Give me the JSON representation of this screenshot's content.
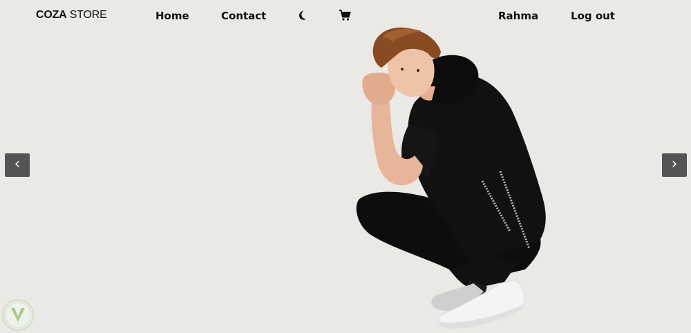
{
  "brand": {
    "bold": "COZA",
    "light": " STORE"
  },
  "nav": {
    "home": "Home",
    "contact": "Contact",
    "user": "Rahma",
    "logout": "Log out"
  },
  "icons": {
    "theme": "moon-icon",
    "cart": "cart-icon"
  },
  "slider": {
    "prev": "‹",
    "next": "›"
  },
  "colors": {
    "background": "#ebe9e6",
    "text": "#111111",
    "arrow_bg": "#545454"
  }
}
